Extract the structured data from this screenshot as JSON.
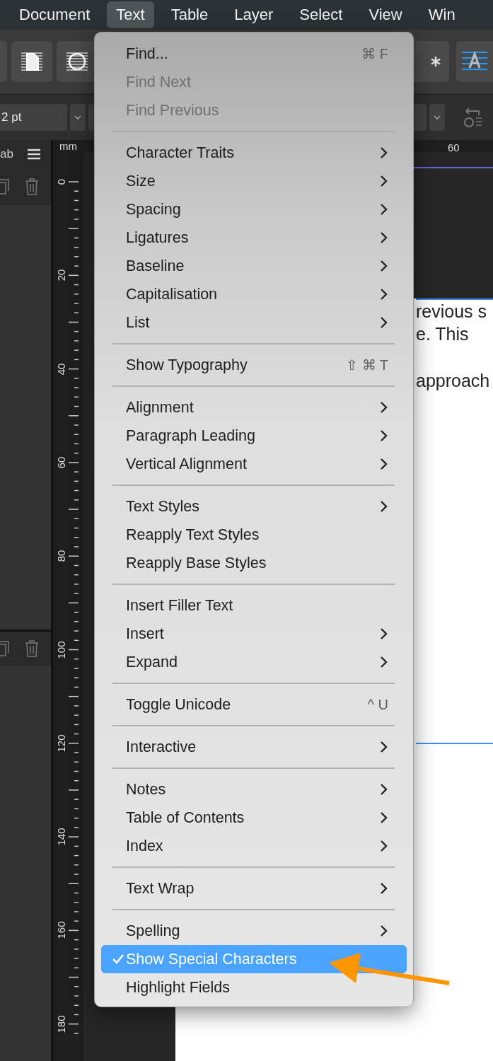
{
  "menubar": [
    {
      "label": "Document",
      "selected": false
    },
    {
      "label": "Text",
      "selected": true
    },
    {
      "label": "Table",
      "selected": false
    },
    {
      "label": "Layer",
      "selected": false
    },
    {
      "label": "Select",
      "selected": false
    },
    {
      "label": "View",
      "selected": false
    },
    {
      "label": "Win",
      "selected": false
    }
  ],
  "context_bar": {
    "field": "2 pt"
  },
  "panel": {
    "tab_label": "ab"
  },
  "rulers": {
    "unit": "mm",
    "horizontal_labels": [
      "60"
    ],
    "vertical_labels": [
      "0",
      "20",
      "40",
      "60",
      "80",
      "100",
      "120",
      "140",
      "160",
      "180"
    ]
  },
  "document": {
    "lines": [
      "revious s",
      "e.  This",
      "approach"
    ]
  },
  "menu": {
    "sections": [
      [
        {
          "label": "Find...",
          "shortcut": "⌘ F",
          "submenu": false,
          "disabled": false,
          "checked": false,
          "selected": false
        },
        {
          "label": "Find Next",
          "submenu": false,
          "disabled": true,
          "checked": false,
          "selected": false
        },
        {
          "label": "Find Previous",
          "submenu": false,
          "disabled": true,
          "checked": false,
          "selected": false
        }
      ],
      [
        {
          "label": "Character Traits",
          "submenu": true,
          "disabled": false,
          "checked": false,
          "selected": false
        },
        {
          "label": "Size",
          "submenu": true,
          "disabled": false,
          "checked": false,
          "selected": false
        },
        {
          "label": "Spacing",
          "submenu": true,
          "disabled": false,
          "checked": false,
          "selected": false
        },
        {
          "label": "Ligatures",
          "submenu": true,
          "disabled": false,
          "checked": false,
          "selected": false
        },
        {
          "label": "Baseline",
          "submenu": true,
          "disabled": false,
          "checked": false,
          "selected": false
        },
        {
          "label": "Capitalisation",
          "submenu": true,
          "disabled": false,
          "checked": false,
          "selected": false
        },
        {
          "label": "List",
          "submenu": true,
          "disabled": false,
          "checked": false,
          "selected": false
        }
      ],
      [
        {
          "label": "Show Typography",
          "shortcut": "⇧ ⌘ T",
          "submenu": false,
          "disabled": false,
          "checked": false,
          "selected": false
        }
      ],
      [
        {
          "label": "Alignment",
          "submenu": true,
          "disabled": false,
          "checked": false,
          "selected": false
        },
        {
          "label": "Paragraph Leading",
          "submenu": true,
          "disabled": false,
          "checked": false,
          "selected": false
        },
        {
          "label": "Vertical Alignment",
          "submenu": true,
          "disabled": false,
          "checked": false,
          "selected": false
        }
      ],
      [
        {
          "label": "Text Styles",
          "submenu": true,
          "disabled": false,
          "checked": false,
          "selected": false
        },
        {
          "label": "Reapply Text Styles",
          "submenu": false,
          "disabled": false,
          "checked": false,
          "selected": false
        },
        {
          "label": "Reapply Base Styles",
          "submenu": false,
          "disabled": false,
          "checked": false,
          "selected": false
        }
      ],
      [
        {
          "label": "Insert Filler Text",
          "submenu": false,
          "disabled": false,
          "checked": false,
          "selected": false
        },
        {
          "label": "Insert",
          "submenu": true,
          "disabled": false,
          "checked": false,
          "selected": false
        },
        {
          "label": "Expand",
          "submenu": true,
          "disabled": false,
          "checked": false,
          "selected": false
        }
      ],
      [
        {
          "label": "Toggle Unicode",
          "shortcut": "^ U",
          "submenu": false,
          "disabled": false,
          "checked": false,
          "selected": false
        }
      ],
      [
        {
          "label": "Interactive",
          "submenu": true,
          "disabled": false,
          "checked": false,
          "selected": false
        }
      ],
      [
        {
          "label": "Notes",
          "submenu": true,
          "disabled": false,
          "checked": false,
          "selected": false
        },
        {
          "label": "Table of Contents",
          "submenu": true,
          "disabled": false,
          "checked": false,
          "selected": false
        },
        {
          "label": "Index",
          "submenu": true,
          "disabled": false,
          "checked": false,
          "selected": false
        }
      ],
      [
        {
          "label": "Text Wrap",
          "submenu": true,
          "disabled": false,
          "checked": false,
          "selected": false
        }
      ],
      [
        {
          "label": "Spelling",
          "submenu": true,
          "disabled": false,
          "checked": false,
          "selected": false
        },
        {
          "label": "Show Special Characters",
          "submenu": false,
          "disabled": false,
          "checked": true,
          "selected": true
        },
        {
          "label": "Highlight Fields",
          "submenu": false,
          "disabled": false,
          "checked": false,
          "selected": false
        }
      ]
    ]
  },
  "annotation": {
    "kind": "arrow"
  }
}
